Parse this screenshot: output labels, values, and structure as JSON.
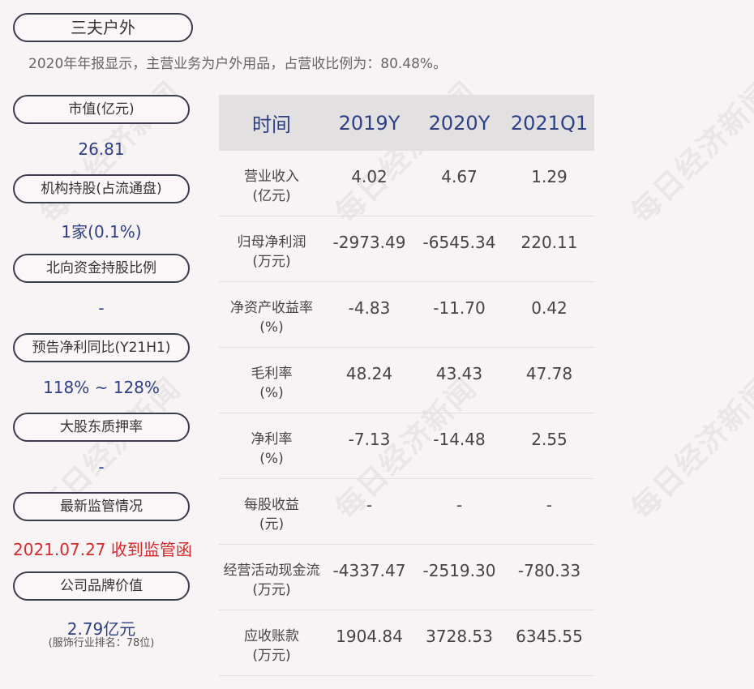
{
  "company": "三夫户外",
  "summary": "2020年年报显示，主营业务为户外用品，占营收比例为：80.48%。",
  "left": [
    {
      "label": "市值(亿元)",
      "value": "26.81",
      "red": false
    },
    {
      "label": "机构持股(占流通盘)",
      "value": "1家(0.1%)",
      "red": false
    },
    {
      "label": "北向资金持股比例",
      "value": "-",
      "red": false
    },
    {
      "label": "预告净利同比(Y21H1)",
      "value": "118% ~ 128%",
      "red": false
    },
    {
      "label": "大股东质押率",
      "value": "-",
      "red": false
    },
    {
      "label": "最新监管情况",
      "value": "2021.07.27 收到监管函",
      "red": true
    },
    {
      "label": "公司品牌价值",
      "value": "2.79亿元",
      "red": false
    }
  ],
  "brand_note": "(服饰行业排名：78位)",
  "table": {
    "headers": [
      "时间",
      "2019Y",
      "2020Y",
      "2021Q1"
    ],
    "rows": [
      {
        "label1": "营业收入",
        "label2": "(亿元)",
        "values": [
          "4.02",
          "4.67",
          "1.29"
        ]
      },
      {
        "label1": "归母净利润",
        "label2": "(万元)",
        "values": [
          "-2973.49",
          "-6545.34",
          "220.11"
        ]
      },
      {
        "label1": "净资产收益率",
        "label2": "(%)",
        "values": [
          "-4.83",
          "-11.70",
          "0.42"
        ]
      },
      {
        "label1": "毛利率",
        "label2": "(%)",
        "values": [
          "48.24",
          "43.43",
          "47.78"
        ]
      },
      {
        "label1": "净利率",
        "label2": "(%)",
        "values": [
          "-7.13",
          "-14.48",
          "2.55"
        ]
      },
      {
        "label1": "每股收益",
        "label2": "(元)",
        "values": [
          "-",
          "-",
          "-"
        ]
      },
      {
        "label1": "经营活动现金流",
        "label2": "(万元)",
        "values": [
          "-4337.47",
          "-2519.30",
          "-780.33"
        ]
      },
      {
        "label1": "应收账款",
        "label2": "(万元)",
        "values": [
          "1904.84",
          "3728.53",
          "6345.55"
        ]
      }
    ]
  },
  "watermark": "每日经济新闻"
}
